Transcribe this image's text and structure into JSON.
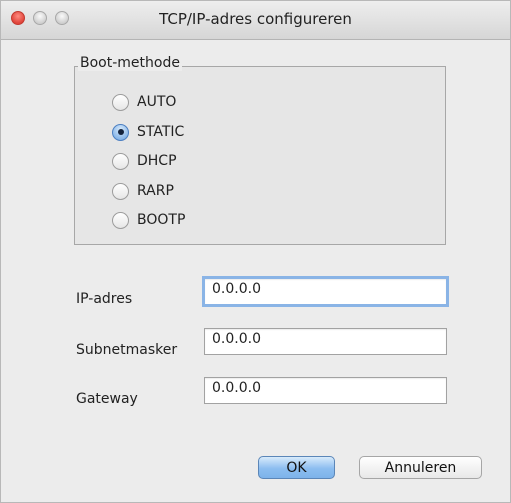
{
  "window": {
    "title": "TCP/IP-adres configureren"
  },
  "boot_method": {
    "legend": "Boot-methode",
    "selected": "STATIC",
    "options": [
      {
        "label": "AUTO",
        "checked": false
      },
      {
        "label": "STATIC",
        "checked": true
      },
      {
        "label": "DHCP",
        "checked": false
      },
      {
        "label": "RARP",
        "checked": false
      },
      {
        "label": "BOOTP",
        "checked": false
      }
    ]
  },
  "fields": {
    "ip": {
      "label": "IP-adres",
      "value": "0.0.0.0"
    },
    "subnet": {
      "label": "Subnetmasker",
      "value": "0.0.0.0"
    },
    "gateway": {
      "label": "Gateway",
      "value": "0.0.0.0"
    }
  },
  "buttons": {
    "ok": "OK",
    "cancel": "Annuleren"
  },
  "colors": {
    "close": "#e0443a",
    "accent": "#7db3ea",
    "window_bg": "#ececec"
  }
}
